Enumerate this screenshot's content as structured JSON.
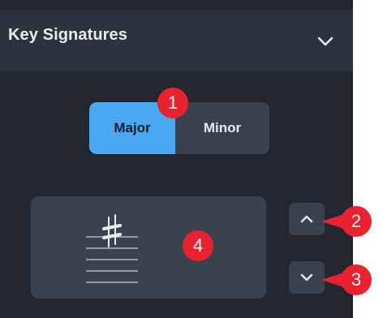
{
  "panel": {
    "title": "Key Signatures",
    "background": "#22272f",
    "header_background": "#2d333c"
  },
  "mode_toggle": {
    "options": [
      "Major",
      "Minor"
    ],
    "selected": "Major",
    "accent": "#4aa8f2"
  },
  "icons": {
    "header": "chevron-down-icon",
    "step_up": "chevron-up-icon",
    "step_down": "chevron-down-icon",
    "key_preview": "sharp-icon"
  },
  "callouts": {
    "c1": "1",
    "c2": "2",
    "c3": "3",
    "c4": "4",
    "color": "#e8222e"
  }
}
